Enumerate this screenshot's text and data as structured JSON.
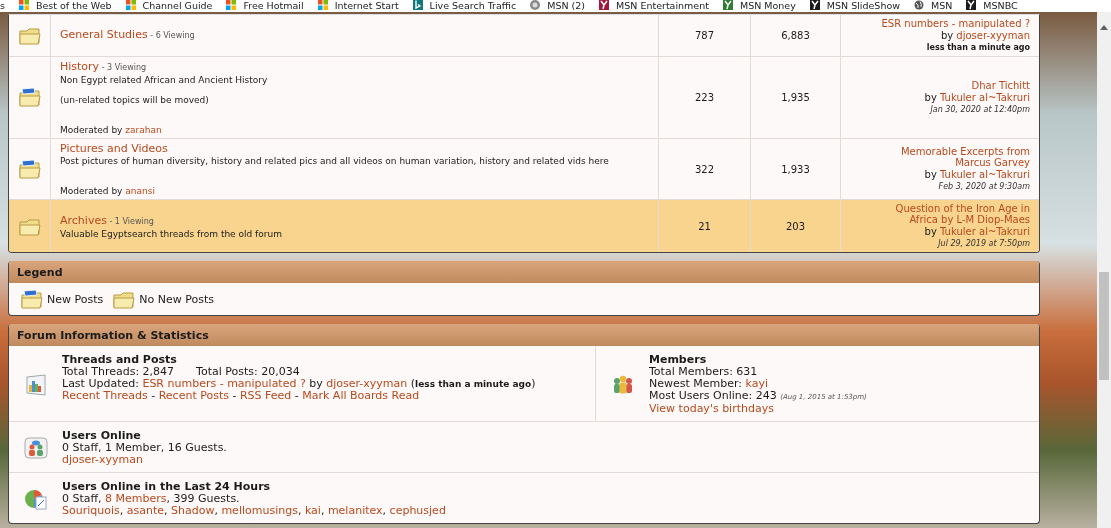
{
  "bookmarks_bar": {
    "items": [
      {
        "label": "s",
        "kind": "plain"
      },
      {
        "label": "Best of the Web",
        "kind": "windows"
      },
      {
        "label": "Channel Guide",
        "kind": "windows"
      },
      {
        "label": "Free Hotmail",
        "kind": "windows"
      },
      {
        "label": "Internet Start",
        "kind": "windows"
      },
      {
        "label": "Live Search Traffic",
        "kind": "bing"
      },
      {
        "label": "MSN (2)",
        "kind": "circle"
      },
      {
        "label": "MSN Entertainment",
        "kind": "tile",
        "color": "#a3163a"
      },
      {
        "label": "MSN Money",
        "kind": "tile",
        "color": "#2f7d32"
      },
      {
        "label": "MSN SlideShow",
        "kind": "tile",
        "color": "#1a1a1a"
      },
      {
        "label": "MSN",
        "kind": "globe"
      },
      {
        "label": "MSNBC",
        "kind": "tile",
        "color": "#1a1a1a"
      }
    ]
  },
  "forums": [
    {
      "new_posts": false,
      "highlighted": false,
      "title": "General Studies",
      "viewing": "- 6 Viewing",
      "topics": "787",
      "posts": "6,883",
      "last_post": {
        "title": "ESR numbers - manipulated ?",
        "by": "by",
        "author": "djoser-xyyman",
        "time": "less than a minute ago",
        "kind": "recent"
      }
    },
    {
      "new_posts": true,
      "highlighted": false,
      "title": "History",
      "viewing": "- 3 Viewing",
      "description": [
        "Non Egypt related African and Ancient History",
        "(un-related topics will be moved)"
      ],
      "moderator": {
        "label": "Moderated by",
        "name": "zarahan"
      },
      "topics": "223",
      "posts": "1,935",
      "last_post": {
        "title": "Dhar Tichitt",
        "by": "by",
        "author": "Tukuler al~Takruri",
        "time": "Jan 30, 2020 at 12:40pm",
        "kind": "date"
      }
    },
    {
      "new_posts": true,
      "highlighted": false,
      "title": "Pictures and Videos",
      "description": [
        "Post pictures of human diversity, history and related pics and all videos on human variation, history and related vids here"
      ],
      "moderator": {
        "label": "Moderated by",
        "name": "anansi"
      },
      "topics": "322",
      "posts": "1,933",
      "last_post": {
        "title": "Memorable Excerpts from Marcus Garvey",
        "by": "by",
        "author": "Tukuler al~Takruri",
        "time": "Feb 3, 2020 at 9:30am",
        "kind": "date"
      }
    },
    {
      "new_posts": false,
      "highlighted": true,
      "title": "Archives",
      "viewing": "- 1 Viewing",
      "description": [
        "Valuable Egyptsearch threads from the old forum"
      ],
      "topics": "21",
      "posts": "203",
      "last_post": {
        "title": "Question of the Iron Age in Africa by L-M Diop-Maes",
        "by": "by",
        "author": "Tukuler al~Takruri",
        "time": "Jul 29, 2019 at 7:50pm",
        "kind": "date"
      }
    }
  ],
  "legend": {
    "title": "Legend",
    "items": [
      {
        "label": "New Posts",
        "new_posts": true
      },
      {
        "label": "No New Posts",
        "new_posts": false
      }
    ]
  },
  "stats": {
    "title": "Forum Information & Statistics",
    "rows": [
      {
        "cells": [
          {
            "kind": "chart",
            "title": "Threads and Posts",
            "lines": [
              [
                {
                  "text": "Total Threads: 2,847",
                  "kind": "plain"
                },
                {
                  "text": "Total Posts: 20,034",
                  "kind": "plain"
                }
              ],
              [
                {
                  "text": "Last Updated: ",
                  "kind": "text"
                },
                {
                  "text": "ESR numbers - manipulated ?",
                  "kind": "link"
                },
                {
                  "text": " by ",
                  "kind": "text"
                },
                {
                  "text": "djoser-xyyman",
                  "kind": "link"
                },
                {
                  "text": " (",
                  "kind": "text"
                },
                {
                  "text": "less than a minute ago",
                  "kind": "bold"
                },
                {
                  "text": ")",
                  "kind": "text"
                }
              ],
              [
                {
                  "text": "Recent Threads",
                  "kind": "link"
                },
                {
                  "text": " - ",
                  "kind": "text"
                },
                {
                  "text": "Recent Posts",
                  "kind": "link"
                },
                {
                  "text": " - ",
                  "kind": "text"
                },
                {
                  "text": "RSS Feed",
                  "kind": "link"
                },
                {
                  "text": " - ",
                  "kind": "text"
                },
                {
                  "text": "Mark All Boards Read",
                  "kind": "link"
                }
              ]
            ]
          },
          {
            "kind": "members",
            "title": "Members",
            "lines": [
              [
                {
                  "text": "Total Members: 631",
                  "kind": "text"
                }
              ],
              [
                {
                  "text": "Newest Member: ",
                  "kind": "text"
                },
                {
                  "text": "kayi",
                  "kind": "link"
                }
              ],
              [
                {
                  "text": "Most Users Online: 243 ",
                  "kind": "text"
                },
                {
                  "text": "(Aug 1, 2015 at 1:53pm)",
                  "kind": "italic"
                }
              ],
              [
                {
                  "text": "View today's birthdays",
                  "kind": "link"
                }
              ]
            ]
          }
        ]
      },
      {
        "cells": [
          {
            "kind": "users",
            "title": "Users Online",
            "lines": [
              [
                {
                  "text": "0 Staff, 1 Member, 16 Guests.",
                  "kind": "text"
                }
              ],
              [
                {
                  "text": "djoser-xyyman",
                  "kind": "link"
                }
              ]
            ]
          }
        ]
      },
      {
        "cells": [
          {
            "kind": "pie",
            "title": "Users Online in the Last 24 Hours",
            "lines": [
              [
                {
                  "text": "0 Staff, ",
                  "kind": "text"
                },
                {
                  "text": "8 Members",
                  "kind": "link"
                },
                {
                  "text": ", 399 Guests.",
                  "kind": "text"
                }
              ],
              [
                {
                  "text": "Souriquois",
                  "kind": "link"
                },
                {
                  "text": ", ",
                  "kind": "text"
                },
                {
                  "text": "asante",
                  "kind": "link"
                },
                {
                  "text": ", ",
                  "kind": "text"
                },
                {
                  "text": "Shadow",
                  "kind": "link"
                },
                {
                  "text": ", ",
                  "kind": "text"
                },
                {
                  "text": "mellomusings",
                  "kind": "link"
                },
                {
                  "text": ", ",
                  "kind": "text"
                },
                {
                  "text": "kai",
                  "kind": "link"
                },
                {
                  "text": ", ",
                  "kind": "text"
                },
                {
                  "text": "melanitex",
                  "kind": "link"
                },
                {
                  "text": ", ",
                  "kind": "text"
                },
                {
                  "text": "cephusjed",
                  "kind": "link"
                }
              ]
            ]
          }
        ]
      }
    ]
  }
}
